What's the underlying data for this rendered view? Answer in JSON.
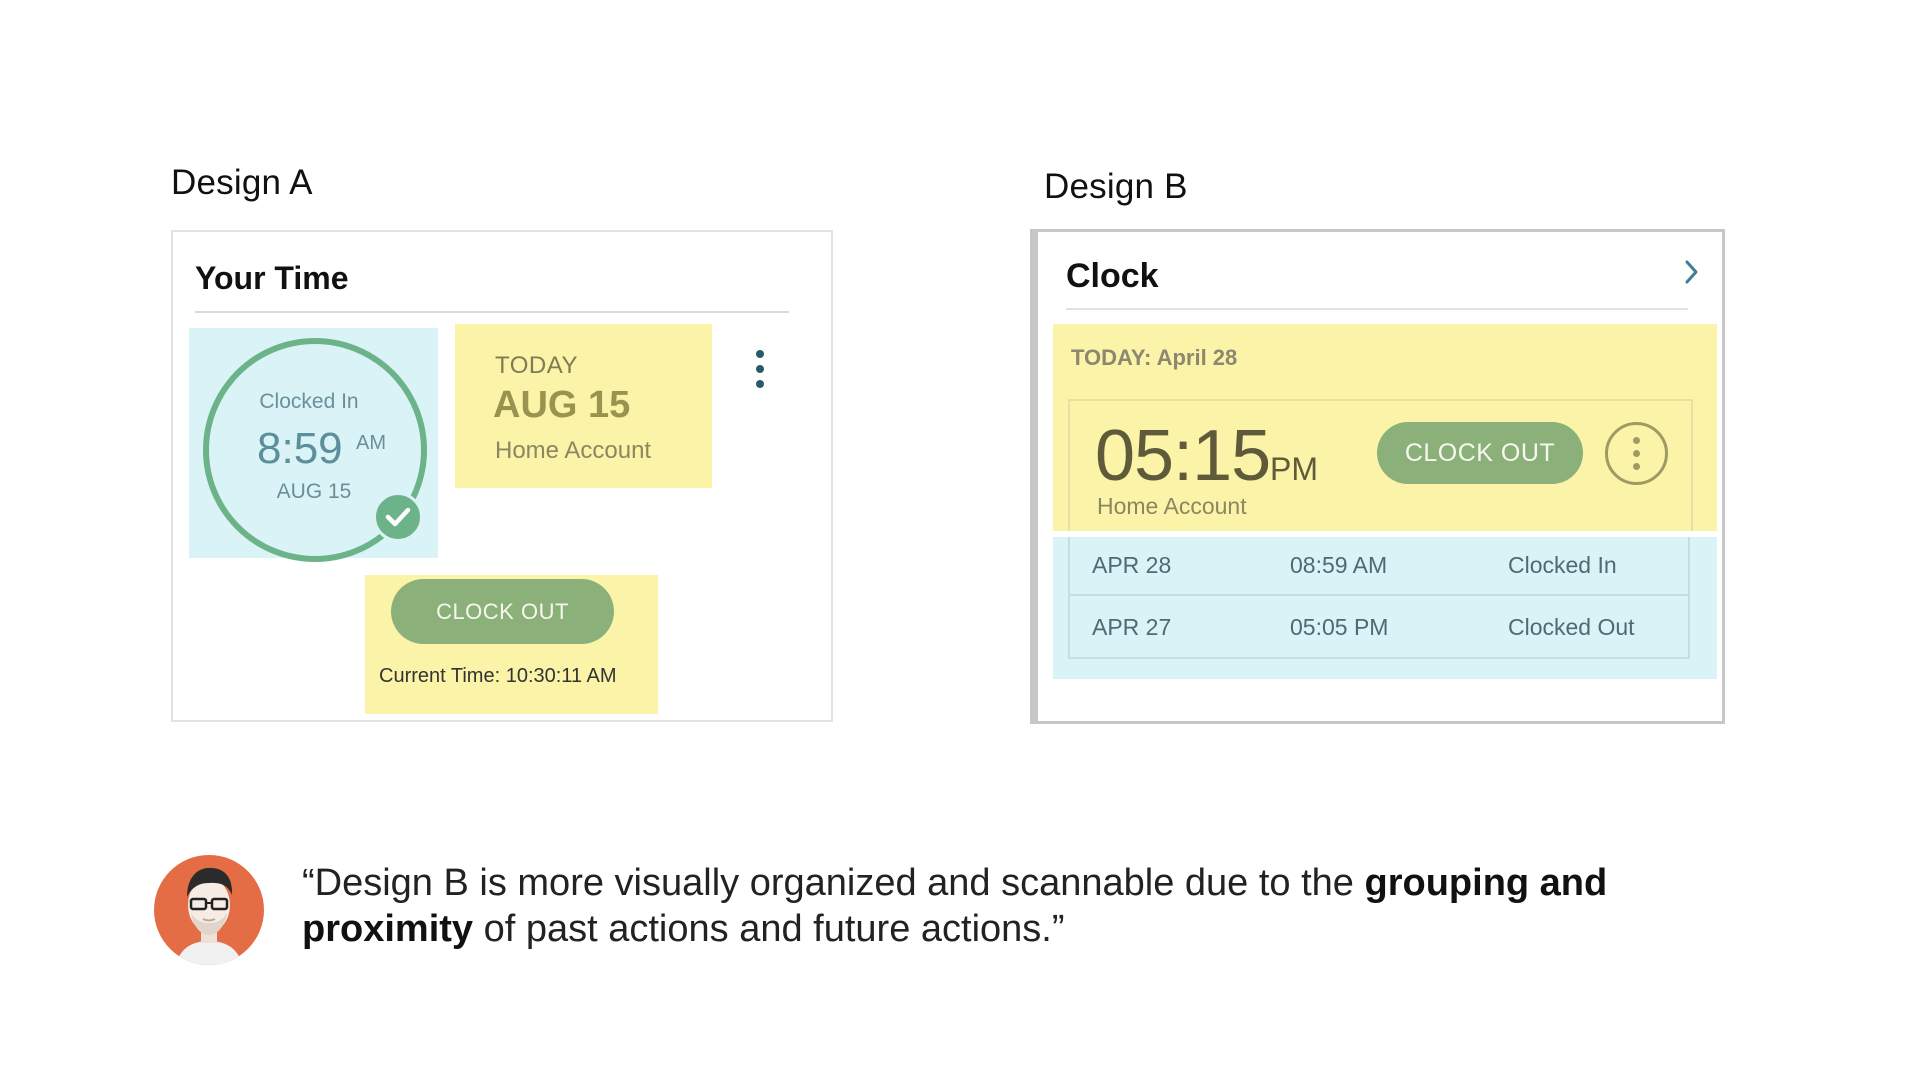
{
  "design_a": {
    "label": "Design A",
    "card_title": "Your Time",
    "clock": {
      "status": "Clocked In",
      "time": "8:59",
      "ampm": "AM",
      "date": "AUG 15"
    },
    "today": {
      "label": "TODAY",
      "date": "AUG 15",
      "account": "Home Account"
    },
    "clock_out_label": "CLOCK OUT",
    "current_time": "Current Time: 10:30:11 AM",
    "highlight_colors": {
      "cyan": "#d9f3f7",
      "yellow": "#faf3a8"
    },
    "button_color": "#8bb079"
  },
  "design_b": {
    "label": "Design B",
    "card_title": "Clock",
    "today_label": "TODAY: April 28",
    "current": {
      "time": "05:15",
      "ampm": "PM",
      "account": "Home Account"
    },
    "clock_out_label": "CLOCK OUT",
    "history": [
      {
        "date": "APR 28",
        "time": "08:59 AM",
        "status": "Clocked In"
      },
      {
        "date": "APR 27",
        "time": "05:05 PM",
        "status": "Clocked Out"
      }
    ]
  },
  "quote": {
    "part1": "“Design B is more visually organized and scannable due to the ",
    "bold": "grouping and proximity",
    "part2": " of past actions and future actions.”"
  },
  "icons": {
    "check": "check-icon",
    "kebab": "more-vertical-icon",
    "chevron": "chevron-right-icon",
    "avatar": "user-avatar"
  }
}
